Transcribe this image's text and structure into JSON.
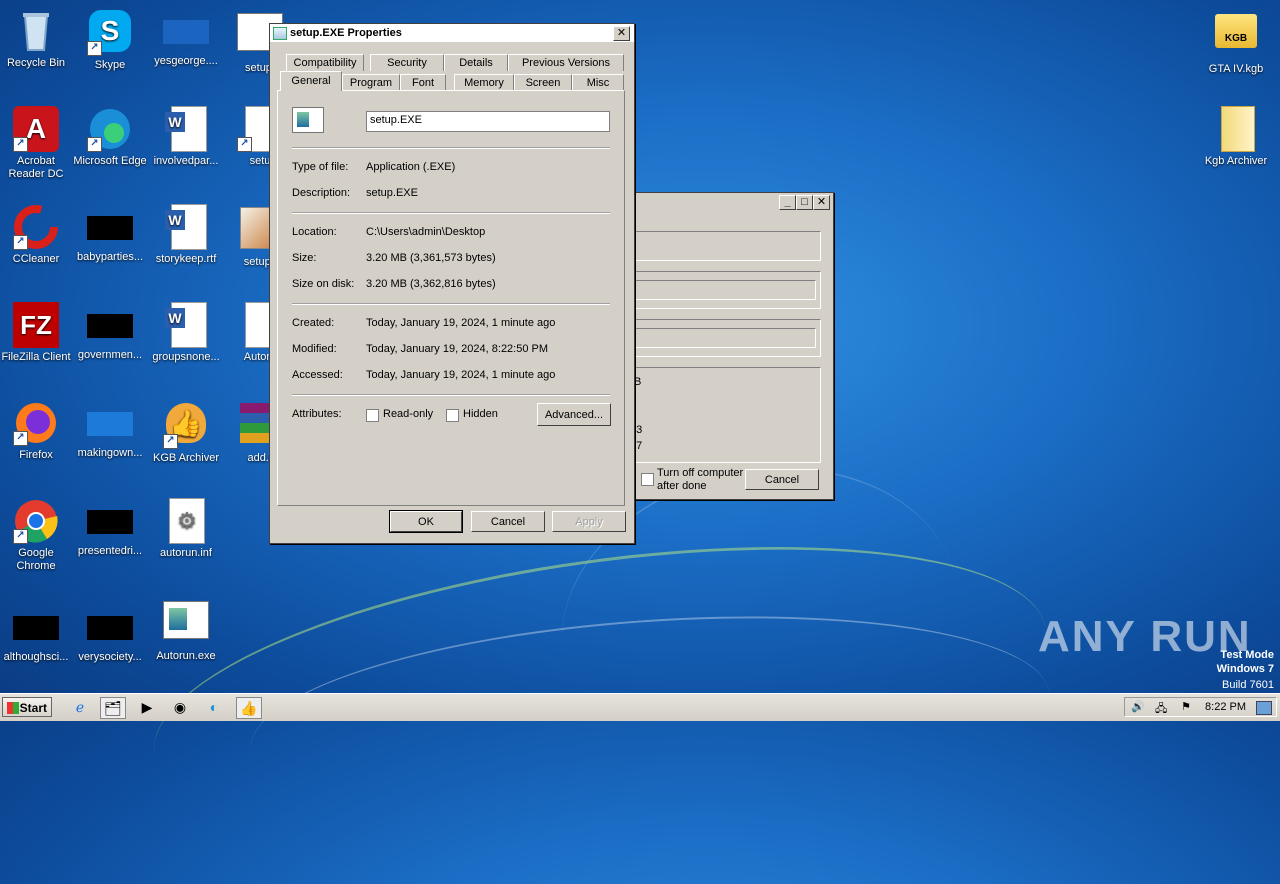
{
  "desktop_icons": [
    {
      "label": "Recycle Bin"
    },
    {
      "label": "Skype"
    },
    {
      "label": "yesgeorge...."
    },
    {
      "label": "setup."
    },
    {
      "label": "Acrobat Reader DC"
    },
    {
      "label": "Microsoft Edge"
    },
    {
      "label": "involvedpar..."
    },
    {
      "label": "setu"
    },
    {
      "label": "CCleaner"
    },
    {
      "label": "babyparties..."
    },
    {
      "label": "storykeep.rtf"
    },
    {
      "label": "setup.l"
    },
    {
      "label": "FileZilla Client"
    },
    {
      "label": "governmen..."
    },
    {
      "label": "groupsnone..."
    },
    {
      "label": "Autoru"
    },
    {
      "label": "Firefox"
    },
    {
      "label": "makingown..."
    },
    {
      "label": "KGB Archiver"
    },
    {
      "label": "add.r"
    },
    {
      "label": "Google Chrome"
    },
    {
      "label": "presentedri..."
    },
    {
      "label": "autorun.inf"
    },
    {
      "label": "althoughsci..."
    },
    {
      "label": "verysociety..."
    },
    {
      "label": "Autorun.exe"
    },
    {
      "label": "GTA IV.kgb"
    },
    {
      "label": "Kgb Archiver"
    }
  ],
  "properties_dialog": {
    "title": "setup.EXE Properties",
    "tabs_row1": [
      "Compatibility",
      "Security",
      "Details",
      "Previous Versions"
    ],
    "tabs_row2": [
      "General",
      "Program",
      "Font",
      "Memory",
      "Screen",
      "Misc"
    ],
    "active_tab": "General",
    "filename": "setup.EXE",
    "fields": {
      "type_label": "Type of file:",
      "type_value": "Application (.EXE)",
      "desc_label": "Description:",
      "desc_value": "setup.EXE",
      "location_label": "Location:",
      "location_value": "C:\\Users\\admin\\Desktop",
      "size_label": "Size:",
      "size_value": "3.20 MB (3,361,573 bytes)",
      "size_disk_label": "Size on disk:",
      "size_disk_value": "3.20 MB (3,362,816 bytes)",
      "created_label": "Created:",
      "created_value": "Today, January 19, 2024, 1 minute ago",
      "modified_label": "Modified:",
      "modified_value": "Today, January 19, 2024, 8:22:50 PM",
      "accessed_label": "Accessed:",
      "accessed_value": "Today, January 19, 2024, 1 minute ago",
      "attributes_label": "Attributes:"
    },
    "readonly_label": "Read-only",
    "hidden_label": "Hidden",
    "advanced_label": "Advanced...",
    "ok_label": "OK",
    "cancel_label": "Cancel",
    "apply_label": "Apply"
  },
  "back_dialog": {
    "fragment_1": "B",
    "fragment_2": "43",
    "fragment_3": "47",
    "turn_off_label": "Turn off computer after done",
    "cancel_label": "Cancel"
  },
  "taskbar": {
    "start_label": "Start",
    "clock": "8:22 PM"
  },
  "watermark": {
    "anyrun": "ANY RUN",
    "line1": "Test Mode",
    "line2": "Windows 7",
    "line3": "Build 7601"
  }
}
